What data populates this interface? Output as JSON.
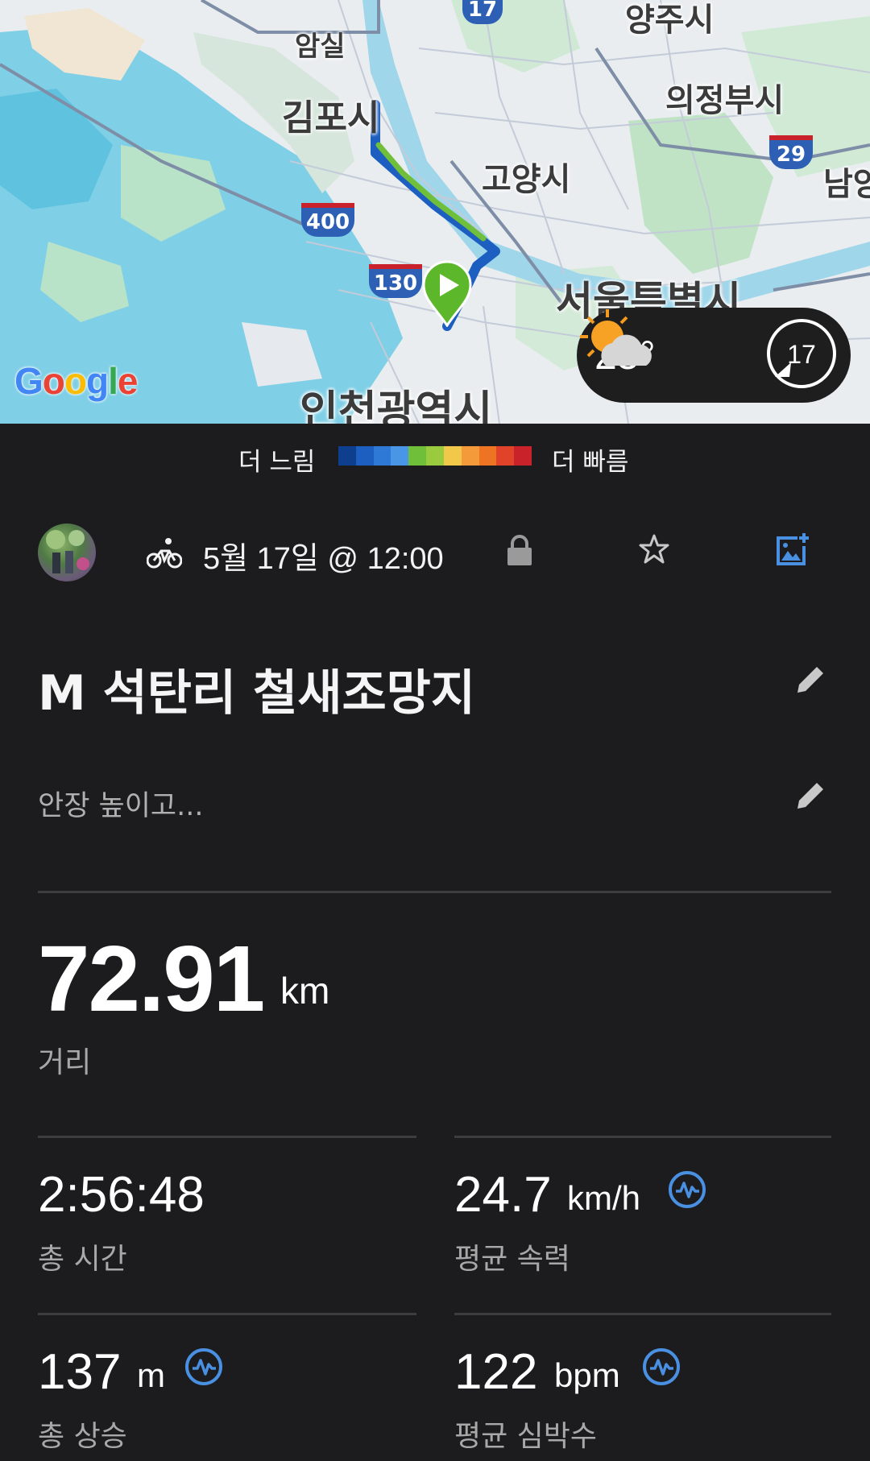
{
  "map": {
    "labels": {
      "amsil": "암실",
      "gimpo": "김포시",
      "goyang": "고양시",
      "uijeongbu": "의정부시",
      "yangju": "양주시",
      "namyang": "남양",
      "seoul": "서울특별시",
      "incheon": "인천광역시"
    },
    "shields": {
      "r17": "17",
      "r29": "29",
      "r400": "400",
      "r130": "130"
    },
    "google_logo": "Google",
    "weather": {
      "temperature": "25°",
      "icon": "partly-cloudy-icon",
      "wind": "17"
    }
  },
  "legend": {
    "slow": "더 느림",
    "fast": "더 빠름",
    "colors": [
      "#0d3f8e",
      "#1d5fc0",
      "#2f79d6",
      "#4a96e6",
      "#6fbf3a",
      "#9acb3f",
      "#f2c84b",
      "#f49a3a",
      "#ee7423",
      "#e0432a",
      "#c9222a"
    ]
  },
  "activity": {
    "type_icon": "bicycle-icon",
    "date": "5월 17일 @ 12:00",
    "title": "M 석탄리 철새조망지",
    "description": "안장 높이고..."
  },
  "stats": {
    "distance": {
      "value": "72.91",
      "unit": "km",
      "label": "거리"
    },
    "total_time": {
      "value": "2:56:48",
      "label": "총 시간"
    },
    "avg_speed": {
      "value": "24.7",
      "unit": "km/h",
      "label": "평균 속력"
    },
    "total_ascent": {
      "value": "137",
      "unit": "m",
      "label": "총 상승"
    },
    "avg_hr": {
      "value": "122",
      "unit": "bpm",
      "label": "평균 심박수"
    }
  },
  "colors": {
    "accent": "#4a90e2",
    "route_start": "#5cb82a",
    "background": "#1c1c1e"
  }
}
